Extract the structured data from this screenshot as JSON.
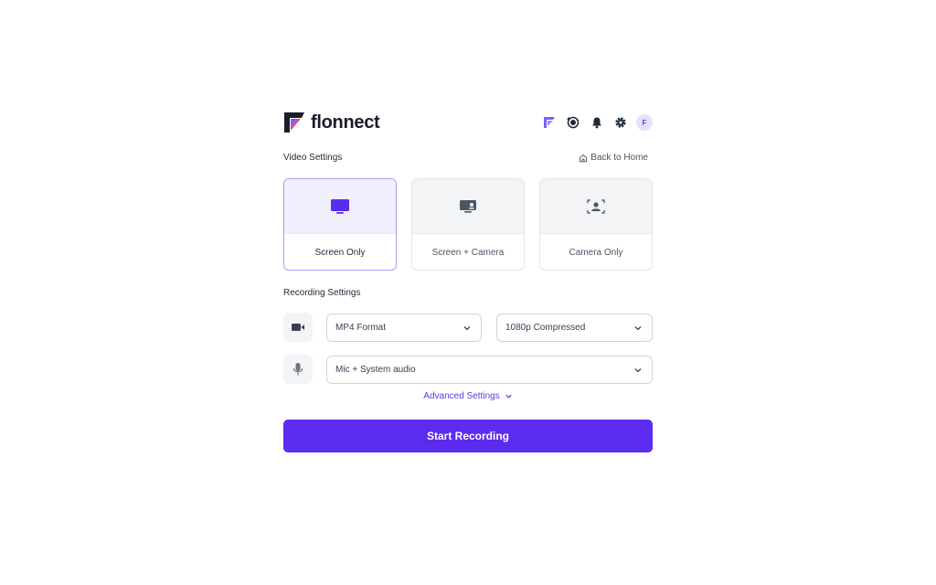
{
  "brand": {
    "name": "flonnect",
    "colors": {
      "accent": "#5b2bf0",
      "logo_purple": "#7b61ff",
      "logo_pink": "#e84a8a",
      "logo_dark": "#1b1b29"
    }
  },
  "header": {
    "icons": [
      "flonnect-logo-icon",
      "history-icon",
      "bell-icon",
      "gear-icon"
    ],
    "avatar_initial": "F"
  },
  "video_settings": {
    "title": "Video Settings",
    "back_link": "Back to Home",
    "modes": [
      {
        "label": "Screen Only",
        "icon": "monitor-icon",
        "selected": true
      },
      {
        "label": "Screen + Camera",
        "icon": "monitor-camera-icon",
        "selected": false
      },
      {
        "label": "Camera Only",
        "icon": "camera-user-icon",
        "selected": false
      }
    ]
  },
  "recording_settings": {
    "title": "Recording Settings",
    "format": {
      "icon": "video-camera-icon",
      "value": "MP4 Format"
    },
    "quality": {
      "value": "1080p Compressed"
    },
    "audio": {
      "icon": "microphone-icon",
      "value": "Mic + System audio"
    },
    "advanced_label": "Advanced Settings"
  },
  "start_button": {
    "label": "Start Recording"
  }
}
